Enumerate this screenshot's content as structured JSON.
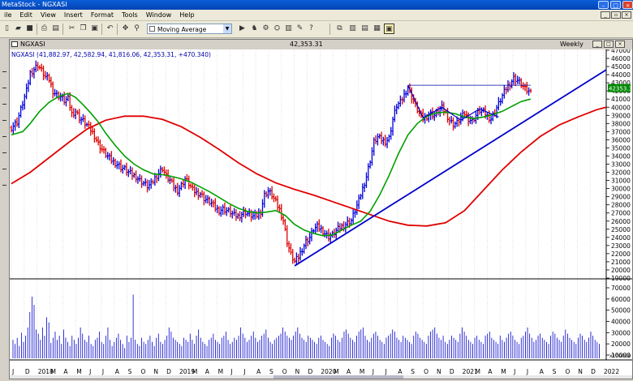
{
  "window": {
    "title": "MetaStock - NGXASI"
  },
  "menu": [
    "ile",
    "Edit",
    "View",
    "Insert",
    "Format",
    "Tools",
    "Window",
    "Help"
  ],
  "toolbar": {
    "indicator_select": "Moving Average"
  },
  "chart_window": {
    "name": "NGXASI",
    "last_price": "42,353.31",
    "period": "Weekly",
    "ohlc_label": "NGXASI (41,882.97, 42,582.94, 41,816.06, 42,353.31, +470.340)",
    "price_badge": "42353.3"
  },
  "colors": {
    "up": "#0000dd",
    "down": "#dd0000",
    "ma_fast": "#00a000",
    "ma_slow": "#e00000",
    "trendline": "#0000cc"
  },
  "chart_data": {
    "type": "line",
    "price_axis": {
      "min": 19000,
      "max": 47000,
      "step": 1000,
      "labels": [
        "47000",
        "46000",
        "45000",
        "44000",
        "43000",
        "42000",
        "41000",
        "40000",
        "39000",
        "38000",
        "37000",
        "36000",
        "35000",
        "34000",
        "33000",
        "32000",
        "31000",
        "30000",
        "29000",
        "28000",
        "27000",
        "26000",
        "25000",
        "24000",
        "23000",
        "22000",
        "21000",
        "20000",
        "19000"
      ]
    },
    "volume_axis": {
      "labels": [
        "70000",
        "60000",
        "50000",
        "40000",
        "30000",
        "20000",
        "10000"
      ],
      "scale_label": "x100000"
    },
    "time_axis": [
      "J",
      "D",
      "2018",
      "M",
      "A",
      "M",
      "J",
      "J",
      "A",
      "S",
      "O",
      "N",
      "D",
      "2019",
      "M",
      "A",
      "M",
      "J",
      "J",
      "A",
      "S",
      "O",
      "N",
      "D",
      "2020",
      "M",
      "A",
      "M",
      "J",
      "J",
      "A",
      "S",
      "O",
      "N",
      "D",
      "2021",
      "M",
      "A",
      "M",
      "J",
      "J",
      "A",
      "S",
      "O",
      "N",
      "D",
      "2022"
    ],
    "price_series": [
      {
        "w": 0,
        "c": 37500
      },
      {
        "w": 3,
        "c": 38200
      },
      {
        "w": 6,
        "c": 40500
      },
      {
        "w": 8,
        "c": 42000
      },
      {
        "w": 10,
        "c": 44200
      },
      {
        "w": 12,
        "c": 44700
      },
      {
        "w": 14,
        "c": 45200
      },
      {
        "w": 16,
        "c": 44500
      },
      {
        "w": 18,
        "c": 43700
      },
      {
        "w": 20,
        "c": 43400
      },
      {
        "w": 22,
        "c": 42000
      },
      {
        "w": 24,
        "c": 41500
      },
      {
        "w": 26,
        "c": 41300
      },
      {
        "w": 28,
        "c": 40800
      },
      {
        "w": 30,
        "c": 41000
      },
      {
        "w": 32,
        "c": 39200
      },
      {
        "w": 34,
        "c": 39500
      },
      {
        "w": 36,
        "c": 38700
      },
      {
        "w": 38,
        "c": 38300
      },
      {
        "w": 40,
        "c": 37800
      },
      {
        "w": 42,
        "c": 37200
      },
      {
        "w": 44,
        "c": 36500
      },
      {
        "w": 46,
        "c": 35500
      },
      {
        "w": 48,
        "c": 34800
      },
      {
        "w": 50,
        "c": 34200
      },
      {
        "w": 52,
        "c": 33700
      },
      {
        "w": 54,
        "c": 33300
      },
      {
        "w": 56,
        "c": 33000
      },
      {
        "w": 58,
        "c": 32600
      },
      {
        "w": 60,
        "c": 32400
      },
      {
        "w": 62,
        "c": 32000
      },
      {
        "w": 64,
        "c": 31700
      },
      {
        "w": 66,
        "c": 31500
      },
      {
        "w": 68,
        "c": 31000
      },
      {
        "w": 70,
        "c": 30700
      },
      {
        "w": 72,
        "c": 30300
      },
      {
        "w": 74,
        "c": 30500
      },
      {
        "w": 76,
        "c": 31300
      },
      {
        "w": 78,
        "c": 31900
      },
      {
        "w": 80,
        "c": 32500
      },
      {
        "w": 82,
        "c": 31500
      },
      {
        "w": 84,
        "c": 31000
      },
      {
        "w": 86,
        "c": 30200
      },
      {
        "w": 88,
        "c": 29800
      },
      {
        "w": 90,
        "c": 30400
      },
      {
        "w": 92,
        "c": 31200
      },
      {
        "w": 94,
        "c": 30600
      },
      {
        "w": 96,
        "c": 29800
      },
      {
        "w": 98,
        "c": 29500
      },
      {
        "w": 100,
        "c": 29400
      },
      {
        "w": 102,
        "c": 28800
      },
      {
        "w": 104,
        "c": 28500
      },
      {
        "w": 106,
        "c": 28200
      },
      {
        "w": 108,
        "c": 27600
      },
      {
        "w": 110,
        "c": 27300
      },
      {
        "w": 112,
        "c": 27500
      },
      {
        "w": 114,
        "c": 27300
      },
      {
        "w": 116,
        "c": 27100
      },
      {
        "w": 118,
        "c": 26700
      },
      {
        "w": 120,
        "c": 26600
      },
      {
        "w": 122,
        "c": 26900
      },
      {
        "w": 124,
        "c": 27100
      },
      {
        "w": 126,
        "c": 26800
      },
      {
        "w": 128,
        "c": 26600
      },
      {
        "w": 130,
        "c": 26700
      },
      {
        "w": 132,
        "c": 27200
      },
      {
        "w": 134,
        "c": 29200
      },
      {
        "w": 136,
        "c": 29700
      },
      {
        "w": 138,
        "c": 29200
      },
      {
        "w": 140,
        "c": 28300
      },
      {
        "w": 142,
        "c": 27400
      },
      {
        "w": 144,
        "c": 26100
      },
      {
        "w": 146,
        "c": 23500
      },
      {
        "w": 148,
        "c": 21900
      },
      {
        "w": 150,
        "c": 21000
      },
      {
        "w": 152,
        "c": 21600
      },
      {
        "w": 154,
        "c": 22600
      },
      {
        "w": 156,
        "c": 23500
      },
      {
        "w": 158,
        "c": 24000
      },
      {
        "w": 160,
        "c": 25000
      },
      {
        "w": 162,
        "c": 25300
      },
      {
        "w": 164,
        "c": 25000
      },
      {
        "w": 166,
        "c": 24500
      },
      {
        "w": 168,
        "c": 24100
      },
      {
        "w": 170,
        "c": 24300
      },
      {
        "w": 172,
        "c": 24800
      },
      {
        "w": 174,
        "c": 25200
      },
      {
        "w": 176,
        "c": 25500
      },
      {
        "w": 178,
        "c": 25800
      },
      {
        "w": 180,
        "c": 26100
      },
      {
        "w": 182,
        "c": 27300
      },
      {
        "w": 184,
        "c": 28500
      },
      {
        "w": 186,
        "c": 30000
      },
      {
        "w": 188,
        "c": 31500
      },
      {
        "w": 190,
        "c": 33500
      },
      {
        "w": 192,
        "c": 35700
      },
      {
        "w": 194,
        "c": 36300
      },
      {
        "w": 196,
        "c": 36000
      },
      {
        "w": 198,
        "c": 35800
      },
      {
        "w": 200,
        "c": 36200
      },
      {
        "w": 202,
        "c": 38500
      },
      {
        "w": 204,
        "c": 40200
      },
      {
        "w": 206,
        "c": 40600
      },
      {
        "w": 208,
        "c": 41500
      },
      {
        "w": 210,
        "c": 42500
      },
      {
        "w": 212,
        "c": 41300
      },
      {
        "w": 214,
        "c": 40200
      },
      {
        "w": 216,
        "c": 39200
      },
      {
        "w": 218,
        "c": 38600
      },
      {
        "w": 220,
        "c": 38900
      },
      {
        "w": 222,
        "c": 39200
      },
      {
        "w": 224,
        "c": 39000
      },
      {
        "w": 226,
        "c": 39600
      },
      {
        "w": 228,
        "c": 39900
      },
      {
        "w": 230,
        "c": 39300
      },
      {
        "w": 232,
        "c": 38400
      },
      {
        "w": 234,
        "c": 37900
      },
      {
        "w": 236,
        "c": 38100
      },
      {
        "w": 238,
        "c": 38700
      },
      {
        "w": 240,
        "c": 39200
      },
      {
        "w": 242,
        "c": 38600
      },
      {
        "w": 244,
        "c": 38300
      },
      {
        "w": 246,
        "c": 39000
      },
      {
        "w": 248,
        "c": 39600
      },
      {
        "w": 250,
        "c": 39400
      },
      {
        "w": 252,
        "c": 38900
      },
      {
        "w": 254,
        "c": 38600
      },
      {
        "w": 256,
        "c": 39500
      },
      {
        "w": 258,
        "c": 40400
      },
      {
        "w": 260,
        "c": 41400
      },
      {
        "w": 262,
        "c": 42300
      },
      {
        "w": 264,
        "c": 42900
      },
      {
        "w": 266,
        "c": 43600
      },
      {
        "w": 268,
        "c": 43300
      },
      {
        "w": 270,
        "c": 42800
      },
      {
        "w": 272,
        "c": 42200
      },
      {
        "w": 274,
        "c": 41900
      },
      {
        "w": 275,
        "c": 42353
      }
    ],
    "ma_fast": [
      {
        "w": 0,
        "c": 36600
      },
      {
        "w": 6,
        "c": 37000
      },
      {
        "w": 10,
        "c": 38000
      },
      {
        "w": 15,
        "c": 39500
      },
      {
        "w": 20,
        "c": 40600
      },
      {
        "w": 25,
        "c": 41300
      },
      {
        "w": 30,
        "c": 41700
      },
      {
        "w": 34,
        "c": 41200
      },
      {
        "w": 38,
        "c": 40300
      },
      {
        "w": 42,
        "c": 39300
      },
      {
        "w": 46,
        "c": 38200
      },
      {
        "w": 50,
        "c": 36800
      },
      {
        "w": 55,
        "c": 35300
      },
      {
        "w": 60,
        "c": 34000
      },
      {
        "w": 65,
        "c": 33000
      },
      {
        "w": 70,
        "c": 32300
      },
      {
        "w": 75,
        "c": 31800
      },
      {
        "w": 80,
        "c": 31700
      },
      {
        "w": 85,
        "c": 31500
      },
      {
        "w": 90,
        "c": 31200
      },
      {
        "w": 95,
        "c": 30800
      },
      {
        "w": 100,
        "c": 30200
      },
      {
        "w": 105,
        "c": 29600
      },
      {
        "w": 110,
        "c": 28900
      },
      {
        "w": 115,
        "c": 28200
      },
      {
        "w": 120,
        "c": 27600
      },
      {
        "w": 125,
        "c": 27200
      },
      {
        "w": 130,
        "c": 27000
      },
      {
        "w": 135,
        "c": 27100
      },
      {
        "w": 140,
        "c": 27300
      },
      {
        "w": 145,
        "c": 26700
      },
      {
        "w": 150,
        "c": 25600
      },
      {
        "w": 155,
        "c": 24900
      },
      {
        "w": 160,
        "c": 24500
      },
      {
        "w": 165,
        "c": 24200
      },
      {
        "w": 170,
        "c": 24300
      },
      {
        "w": 175,
        "c": 24900
      },
      {
        "w": 180,
        "c": 25500
      },
      {
        "w": 185,
        "c": 26000
      },
      {
        "w": 190,
        "c": 27200
      },
      {
        "w": 195,
        "c": 29200
      },
      {
        "w": 200,
        "c": 31600
      },
      {
        "w": 205,
        "c": 34300
      },
      {
        "w": 210,
        "c": 36600
      },
      {
        "w": 215,
        "c": 38000
      },
      {
        "w": 220,
        "c": 38900
      },
      {
        "w": 225,
        "c": 39300
      },
      {
        "w": 230,
        "c": 39400
      },
      {
        "w": 235,
        "c": 39200
      },
      {
        "w": 240,
        "c": 38800
      },
      {
        "w": 245,
        "c": 38600
      },
      {
        "w": 250,
        "c": 38800
      },
      {
        "w": 255,
        "c": 39100
      },
      {
        "w": 260,
        "c": 39500
      },
      {
        "w": 265,
        "c": 40100
      },
      {
        "w": 270,
        "c": 40700
      },
      {
        "w": 275,
        "c": 41000
      }
    ],
    "ma_slow": [
      {
        "w": 0,
        "c": 30600
      },
      {
        "w": 10,
        "c": 32000
      },
      {
        "w": 20,
        "c": 33800
      },
      {
        "w": 30,
        "c": 35600
      },
      {
        "w": 40,
        "c": 37300
      },
      {
        "w": 50,
        "c": 38400
      },
      {
        "w": 60,
        "c": 38900
      },
      {
        "w": 70,
        "c": 38900
      },
      {
        "w": 80,
        "c": 38500
      },
      {
        "w": 90,
        "c": 37600
      },
      {
        "w": 100,
        "c": 36300
      },
      {
        "w": 110,
        "c": 34800
      },
      {
        "w": 120,
        "c": 33200
      },
      {
        "w": 130,
        "c": 31800
      },
      {
        "w": 140,
        "c": 30700
      },
      {
        "w": 150,
        "c": 29900
      },
      {
        "w": 160,
        "c": 29200
      },
      {
        "w": 170,
        "c": 28400
      },
      {
        "w": 180,
        "c": 27600
      },
      {
        "w": 190,
        "c": 26800
      },
      {
        "w": 200,
        "c": 26000
      },
      {
        "w": 210,
        "c": 25500
      },
      {
        "w": 220,
        "c": 25400
      },
      {
        "w": 230,
        "c": 25800
      },
      {
        "w": 240,
        "c": 27300
      },
      {
        "w": 250,
        "c": 29800
      },
      {
        "w": 260,
        "c": 32300
      },
      {
        "w": 270,
        "c": 34500
      },
      {
        "w": 280,
        "c": 36400
      },
      {
        "w": 290,
        "c": 37800
      },
      {
        "w": 300,
        "c": 38800
      },
      {
        "w": 310,
        "c": 39700
      },
      {
        "w": 315,
        "c": 40000
      }
    ],
    "volume": [
      18,
      14,
      20,
      12,
      25,
      16,
      22,
      30,
      45,
      60,
      52,
      28,
      24,
      18,
      30,
      22,
      40,
      35,
      15,
      20,
      26,
      18,
      22,
      14,
      28,
      20,
      16,
      12,
      22,
      18,
      14,
      20,
      30,
      24,
      18,
      16,
      22,
      14,
      12,
      18,
      20,
      26,
      16,
      14,
      22,
      30,
      18,
      12,
      16,
      20,
      24,
      18,
      14,
      10,
      22,
      16,
      20,
      62,
      18,
      14,
      12,
      20,
      16,
      14,
      18,
      22,
      16,
      12,
      20,
      24,
      16,
      14,
      18,
      22,
      30,
      26,
      20,
      18,
      16,
      14,
      12,
      20,
      18,
      16,
      24,
      18,
      14,
      22,
      28,
      20,
      16,
      14,
      12,
      18,
      20,
      24,
      18,
      16,
      14,
      20,
      22,
      26,
      18,
      14,
      16,
      20,
      18,
      22,
      30,
      24,
      20,
      16,
      18,
      22,
      26,
      20,
      16,
      18,
      22,
      24,
      28,
      20,
      16,
      14,
      18,
      20,
      22,
      24,
      30,
      26,
      22,
      20,
      18,
      22,
      26,
      30,
      24,
      20,
      18,
      16,
      22,
      20,
      18,
      16,
      14,
      20,
      22,
      18,
      16,
      14,
      12,
      20,
      24,
      22,
      18,
      16,
      20,
      26,
      28,
      24,
      20,
      18,
      16,
      22,
      26,
      28,
      30,
      22,
      18,
      16,
      20,
      24,
      26,
      22,
      18,
      16,
      14,
      20,
      22,
      24,
      28,
      26,
      20,
      18,
      16,
      22,
      20,
      18,
      16,
      14,
      22,
      26,
      24,
      20,
      18,
      16,
      14,
      22,
      26,
      28,
      30,
      24,
      20,
      18,
      22,
      16,
      14,
      18,
      22,
      20,
      18,
      16,
      24,
      30,
      26,
      22,
      18,
      16,
      14,
      20,
      22,
      18,
      16,
      14,
      22,
      24,
      26,
      20,
      18,
      16,
      14,
      22,
      18,
      16,
      20,
      24,
      26,
      22,
      18,
      16,
      14,
      20,
      22,
      26,
      30,
      24,
      20,
      16,
      18,
      22,
      24,
      20,
      18,
      16,
      14,
      22,
      26,
      24,
      20,
      18,
      16,
      22,
      28,
      24,
      20,
      18,
      16,
      14,
      20,
      24,
      22,
      18,
      16,
      20,
      26,
      22,
      18,
      16,
      14
    ]
  }
}
